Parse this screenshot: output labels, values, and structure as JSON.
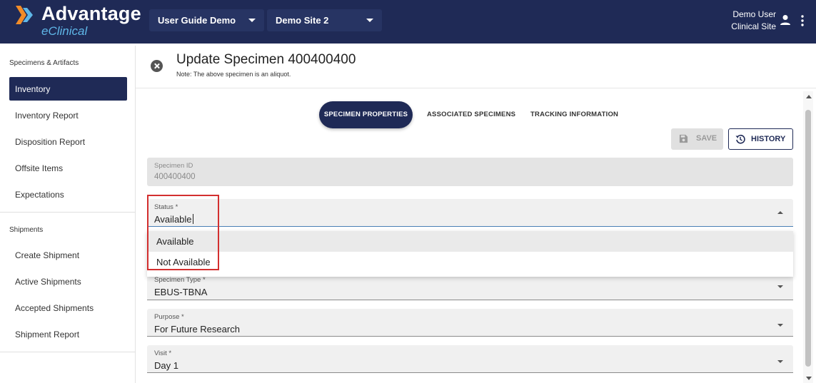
{
  "header": {
    "logo_title": "Advantage",
    "logo_subtitle": "eClinical",
    "study_select": "User Guide Demo",
    "site_select": "Demo Site 2",
    "user_name": "Demo User",
    "user_site": "Clinical Site"
  },
  "sidebar": {
    "section1_title": "Specimens & Artifacts",
    "section1_items": [
      "Inventory",
      "Inventory Report",
      "Disposition Report",
      "Offsite Items",
      "Expectations"
    ],
    "section2_title": "Shipments",
    "section2_items": [
      "Create Shipment",
      "Active Shipments",
      "Accepted Shipments",
      "Shipment Report"
    ],
    "active_item": "Inventory"
  },
  "main": {
    "title": "Update Specimen 400400400",
    "note": "Note: The above specimen is an aliquot.",
    "tabs": [
      "SPECIMEN PROPERTIES",
      "ASSOCIATED SPECIMENS",
      "TRACKING INFORMATION"
    ],
    "active_tab": "SPECIMEN PROPERTIES",
    "save_label": "SAVE",
    "history_label": "HISTORY",
    "fields": {
      "specimen_id": {
        "label": "Specimen ID",
        "value": "400400400"
      },
      "status": {
        "label": "Status *",
        "value": "Available"
      },
      "specimen_type": {
        "label": "Specimen Type *",
        "value": "EBUS-TBNA"
      },
      "purpose": {
        "label": "Purpose *",
        "value": "For Future Research"
      },
      "visit": {
        "label": "Visit *",
        "value": "Day 1"
      }
    },
    "status_options": [
      "Available",
      "Not Available"
    ],
    "highlighted_option": "Available"
  },
  "colors": {
    "primary": "#1f2a56",
    "accent_light_blue": "#5fb7e8",
    "annotation_red": "#d32f2f"
  },
  "icons": [
    "logo-chevron-icon",
    "user-icon",
    "kebab-menu-icon",
    "close-circle-icon",
    "save-icon",
    "history-icon",
    "chevron-down-icon",
    "chevron-up-icon"
  ]
}
